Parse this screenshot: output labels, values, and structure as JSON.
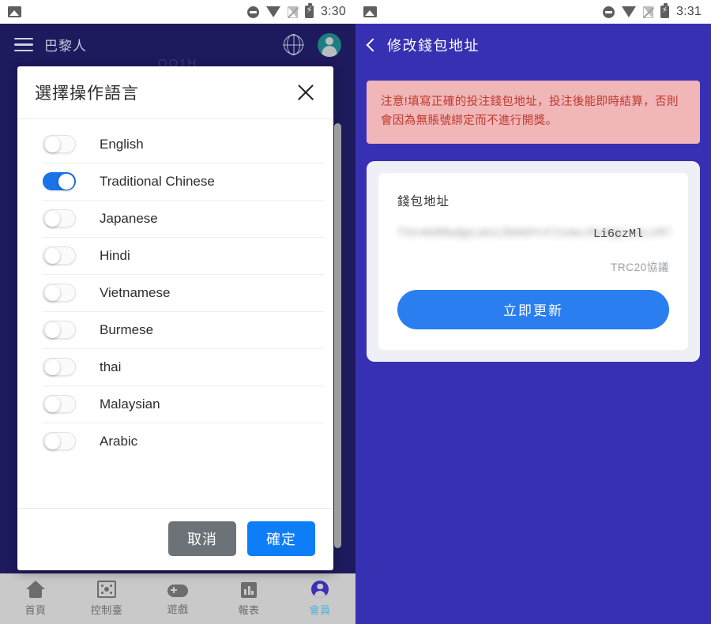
{
  "left": {
    "statusbar": {
      "time": "3:30",
      "icons": [
        "photo-icon",
        "dnd-icon",
        "wifi-icon",
        "signal-off-icon",
        "battery-charging-icon"
      ]
    },
    "appbar": {
      "title": "巴黎人",
      "menu_icon": "hamburger-icon",
      "globe_icon": "globe-icon",
      "avatar_icon": "user-avatar-icon"
    },
    "background_text": "QQ1H",
    "dialog": {
      "title": "選擇操作語言",
      "close_icon": "close-icon",
      "languages": [
        {
          "label": "English",
          "enabled": false
        },
        {
          "label": "Traditional Chinese",
          "enabled": true
        },
        {
          "label": "Japanese",
          "enabled": false
        },
        {
          "label": "Hindi",
          "enabled": false
        },
        {
          "label": "Vietnamese",
          "enabled": false
        },
        {
          "label": "Burmese",
          "enabled": false
        },
        {
          "label": "thai",
          "enabled": false
        },
        {
          "label": "Malaysian",
          "enabled": false
        },
        {
          "label": "Arabic",
          "enabled": false
        }
      ],
      "cancel_label": "取消",
      "confirm_label": "確定"
    },
    "bottom_nav": {
      "items": [
        {
          "label": "首頁",
          "icon": "home-icon",
          "active": false
        },
        {
          "label": "控制臺",
          "icon": "console-icon",
          "active": false
        },
        {
          "label": "遊戲",
          "icon": "gamepad-icon",
          "active": false
        },
        {
          "label": "報表",
          "icon": "chart-icon",
          "active": false
        },
        {
          "label": "會員",
          "icon": "member-icon",
          "active": true
        }
      ]
    }
  },
  "right": {
    "statusbar": {
      "time": "3:31"
    },
    "appbar": {
      "title": "修改錢包地址",
      "back_icon": "back-chevron-icon"
    },
    "warning": {
      "text": "注意!填寫正確的投注錢包地址，投注後能即時結算，否則會因為無賬號綁定而不進行開獎。"
    },
    "card": {
      "wallet_label": "錢包地址",
      "address_masked": "TXn4kR8wQpLmVz3bHdYcF2sAeJ9uNgLi6czMlQv7tRx",
      "address_visible_fragment": "Li6czMl",
      "protocol_note": "TRC20協議",
      "update_label": "立即更新"
    }
  },
  "colors": {
    "left_appbar": "#1d1a5e",
    "right_bg": "#3730b3",
    "accent_blue": "#1a73e8",
    "button_blue": "#2b7ef0",
    "cancel_gray": "#6c7278",
    "warning_bg": "#f0b6b8",
    "warning_text": "#c0392b",
    "active_nav": "#4fb3d9"
  }
}
